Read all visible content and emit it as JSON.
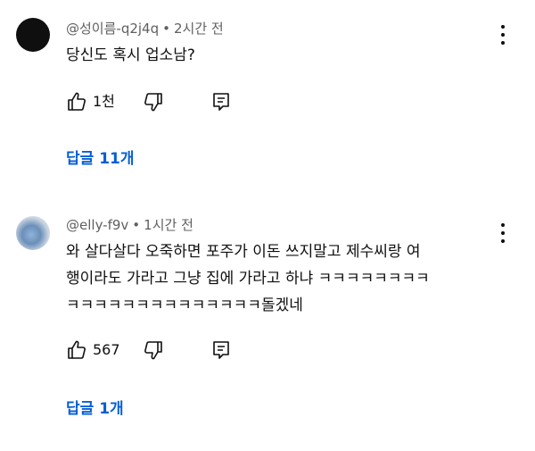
{
  "comments": [
    {
      "author": "@성이름-q2j4q",
      "separator": "•",
      "time": "2시간 전",
      "lines": [
        "당신도 혹시 업소남?"
      ],
      "likes": "1천",
      "replies": "답글 11개"
    },
    {
      "author": "@elly-f9v",
      "separator": "•",
      "time": "1시간 전",
      "lines": [
        "와 살다살다 오죽하면 포주가 이돈 쓰지말고 제수씨랑 여",
        "행이라도 가라고 그냥 집에 가라고 하냐 ㅋㅋㅋㅋㅋㅋㅋㅋ",
        "ㅋㅋㅋㅋㅋㅋㅋㅋㅋㅋㅋㅋㅋㅋ돌겠네"
      ],
      "likes": "567",
      "replies": "답글 1개"
    }
  ]
}
